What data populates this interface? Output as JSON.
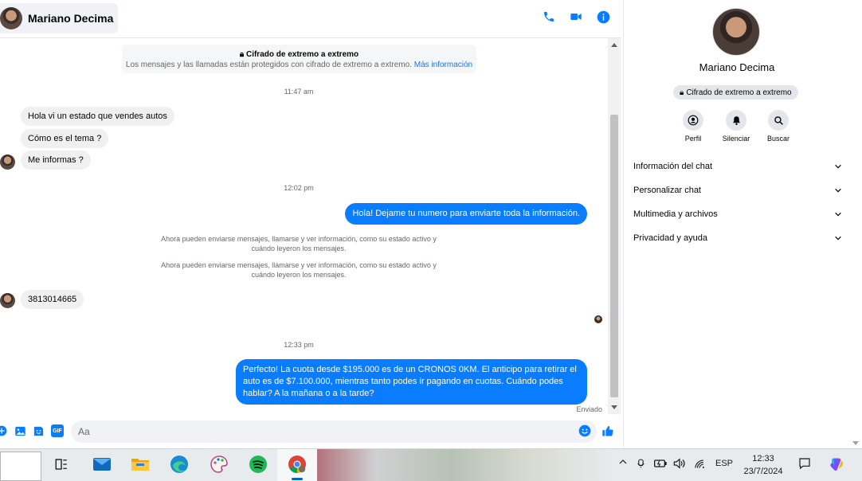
{
  "header": {
    "contact_name": "Mariano Decima",
    "icons": [
      "phone-icon",
      "video-call-icon",
      "info-icon"
    ]
  },
  "banner": {
    "title": "Cifrado de extremo a extremo",
    "text": "Los mensajes y las llamadas están protegidos con cifrado de extremo a extremo.",
    "link": "Más información"
  },
  "messages": {
    "ts1": "11:47 am",
    "in1": "Hola vi un estado que vendes autos",
    "in2": "Cómo es el tema ?",
    "in3": "Me informas ?",
    "ts2": "12:02 pm",
    "out1": "Hola! Dejame tu numero  para enviarte toda la información.",
    "sys1": "Ahora pueden enviarse mensajes, llamarse y ver información, como su estado activo y cuándo leyeron los mensajes.",
    "sys2": "Ahora pueden enviarse mensajes, llamarse y ver información, como su estado activo y cuándo leyeron los mensajes.",
    "in4": "3813014665",
    "ts3": "12:33 pm",
    "out2": "Perfecto! La cuota desde $195.000 es de un CRONOS 0KM. El anticipo para retirar el auto es de $7.100.000, mientras tanto podes ir pagando en cuotas. Cuándo podes hablar? A la mañana o a la tarde?",
    "status": "Enviado"
  },
  "composer": {
    "placeholder": "Aa",
    "icons": [
      "plus-icon",
      "image-icon",
      "sticker-icon",
      "gif-icon",
      "emoji-icon",
      "like-icon"
    ],
    "gif_label": "GIF"
  },
  "info_pane": {
    "name": "Mariano Decima",
    "badge": "Cifrado de extremo a extremo",
    "actions": [
      {
        "label": "Perfil",
        "icon": "profile-icon"
      },
      {
        "label": "Silenciar",
        "icon": "bell-icon"
      },
      {
        "label": "Buscar",
        "icon": "search-icon"
      }
    ],
    "sections": [
      "Información del chat",
      "Personalizar chat",
      "Multimedia y archivos",
      "Privacidad y ayuda"
    ]
  },
  "taskbar": {
    "apps": [
      "task-view-icon",
      "mail-icon",
      "file-explorer-icon",
      "edge-icon",
      "paint-icon",
      "spotify-icon",
      "chrome-icon"
    ],
    "language": "ESP",
    "time": "12:33",
    "date": "23/7/2024",
    "colors": {
      "accent": "#0067c0",
      "messenger_blue": "#0a7cff"
    }
  }
}
